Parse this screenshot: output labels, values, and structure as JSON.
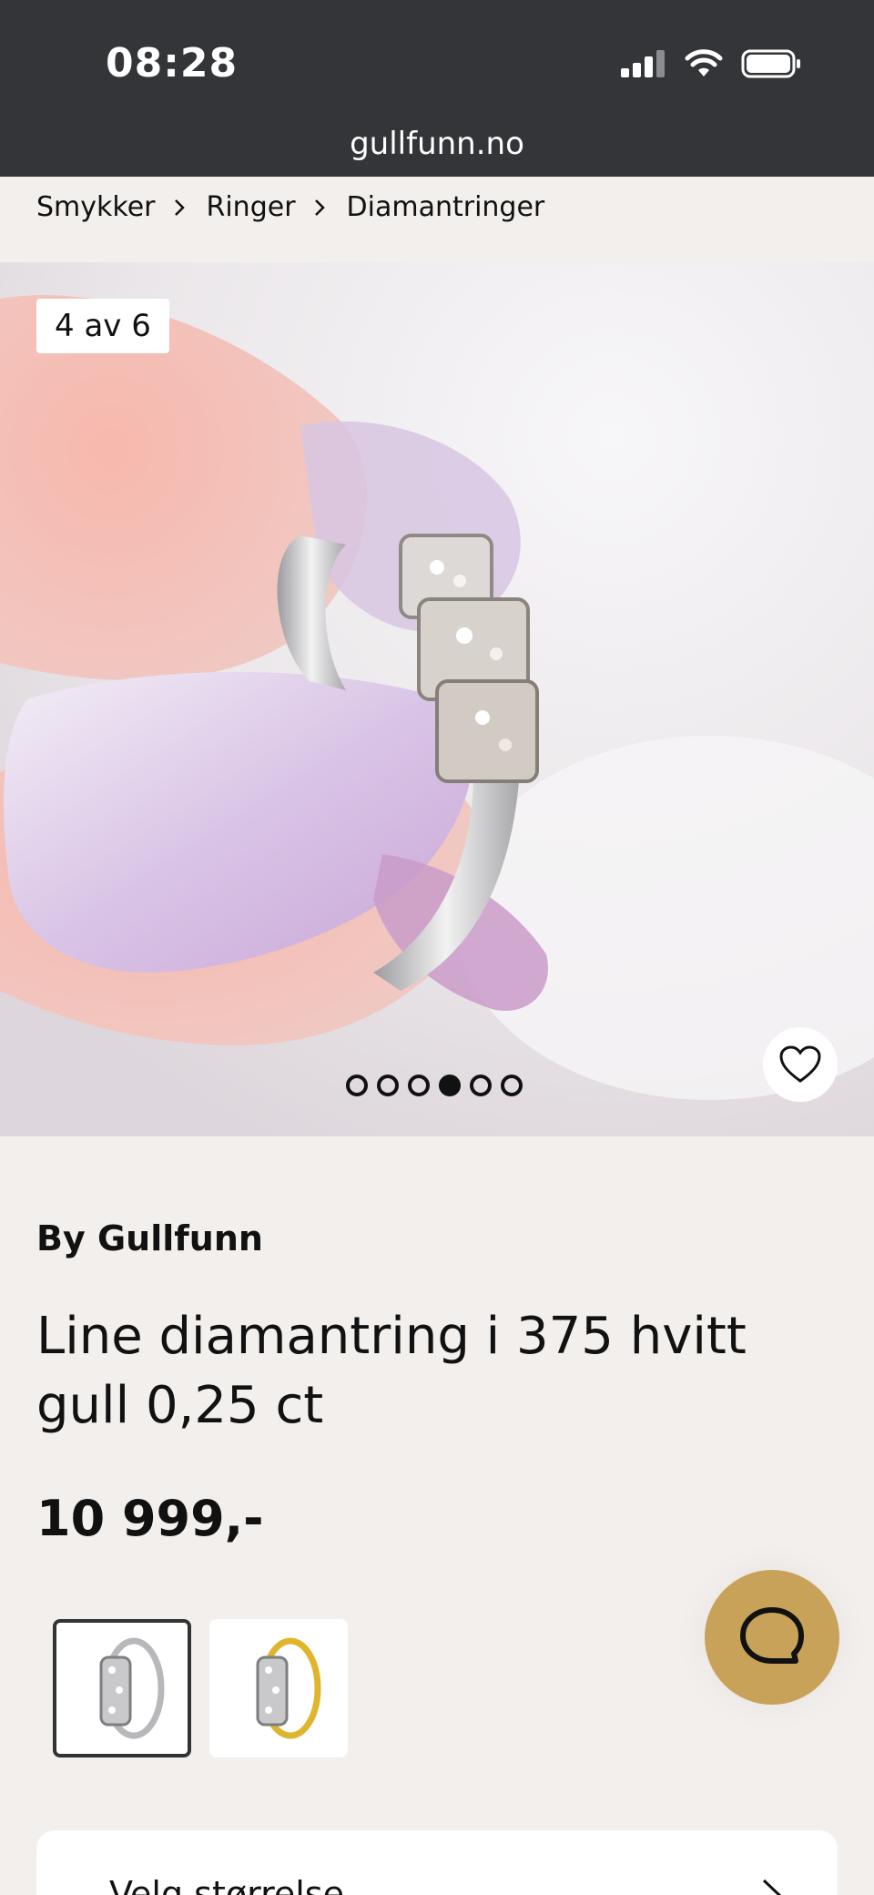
{
  "status_bar": {
    "time": "08:28"
  },
  "browser": {
    "url": "gullfunn.no"
  },
  "breadcrumb": [
    "Smykker",
    "Ringer",
    "Diamantringer"
  ],
  "gallery": {
    "counter": "4 av 6",
    "total_images": 6,
    "active_index": 4,
    "image_icon": "ring-on-finger-photo"
  },
  "product": {
    "brand": "By Gullfunn",
    "title": "Line diamantring i 375 hvitt gull 0,25 ct",
    "price": "10 999,-"
  },
  "variants": [
    {
      "name": "white-gold-ring",
      "selected": true
    },
    {
      "name": "yellow-gold-ring",
      "selected": false
    }
  ],
  "size_selector": {
    "label": "Velg størrelse"
  },
  "colors": {
    "accent": "#c9a25a",
    "topbar": "#333538",
    "background": "#f2efec"
  }
}
